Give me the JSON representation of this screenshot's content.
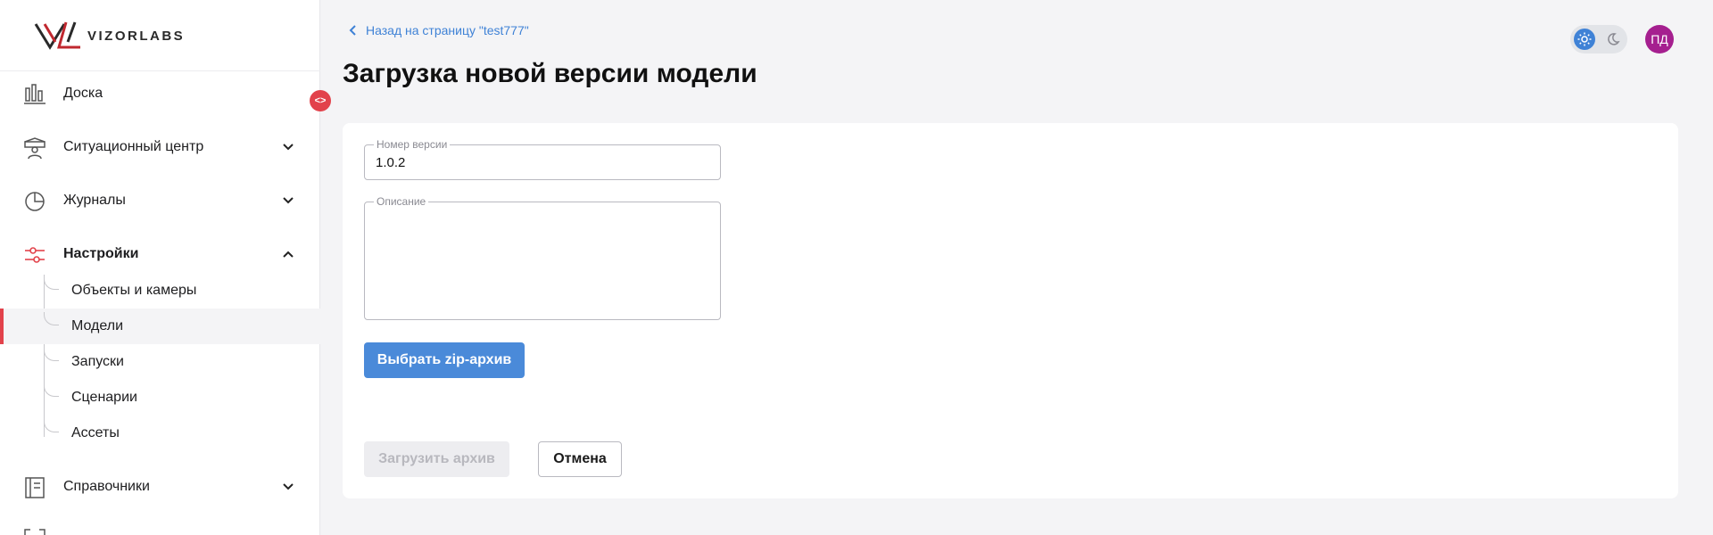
{
  "brand": {
    "name": "VIZORLABS",
    "accent": "#e2424b",
    "primary": "#4a8ad9"
  },
  "sidebar": {
    "items": [
      {
        "label": "Доска",
        "icon": "dashboard-icon"
      },
      {
        "label": "Ситуационный центр",
        "icon": "situation-center-icon",
        "expanded": false
      },
      {
        "label": "Журналы",
        "icon": "journals-icon",
        "expanded": false
      },
      {
        "label": "Настройки",
        "icon": "settings-icon",
        "expanded": true,
        "active": true
      },
      {
        "label": "Справочники",
        "icon": "reference-book-icon",
        "expanded": false
      }
    ],
    "subitems": [
      {
        "label": "Объекты и камеры"
      },
      {
        "label": "Модели",
        "selected": true
      },
      {
        "label": "Запуски"
      },
      {
        "label": "Сценарии"
      },
      {
        "label": "Ассеты"
      }
    ],
    "collapse_label": "<>"
  },
  "header": {
    "back_label": "Назад на страницу \"test777\"",
    "title": "Загрузка новой версии модели",
    "avatar_initials": "ПД",
    "theme": "light"
  },
  "form": {
    "version_label": "Номер версии",
    "version_value": "1.0.2",
    "description_label": "Описание",
    "description_value": "",
    "select_zip_label": "Выбрать zip-архив",
    "upload_label": "Загрузить архив",
    "cancel_label": "Отмена"
  }
}
